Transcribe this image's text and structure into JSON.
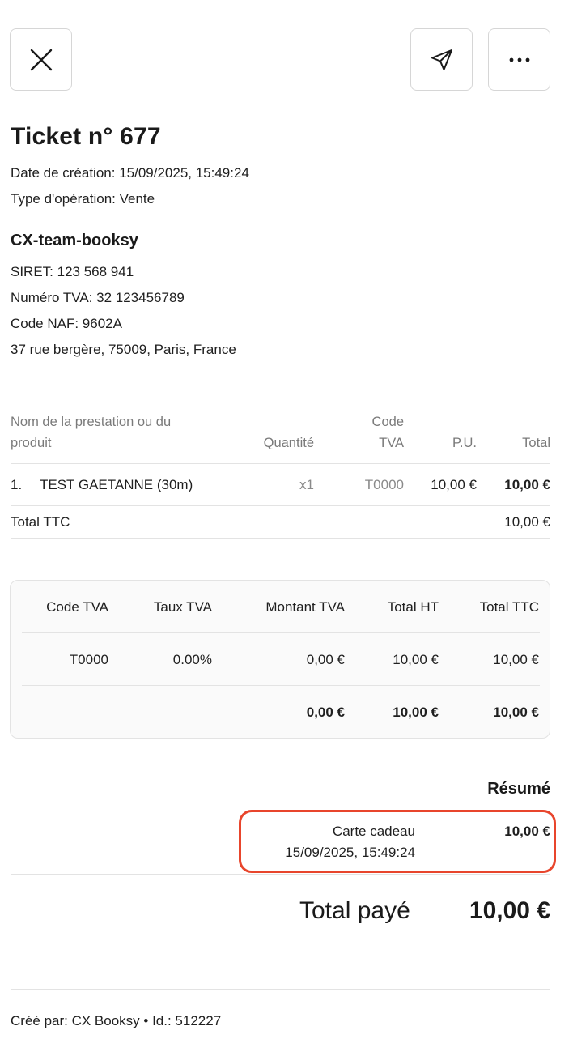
{
  "toolbar": {
    "close_icon": "close-icon",
    "send_icon": "send-icon",
    "more_icon": "more-icon"
  },
  "ticket": {
    "title": "Ticket n° 677",
    "created": "Date de création: 15/09/2025, 15:49:24",
    "operation": "Type d'opération: Vente"
  },
  "business": {
    "name": "CX-team-booksy",
    "siret": "SIRET: 123 568 941",
    "tva": "Numéro TVA: 32 123456789",
    "naf": "Code NAF: 9602A",
    "address": "37 rue bergère, 75009, Paris, France"
  },
  "items_table": {
    "headers": {
      "name_line1": "Nom de la prestation ou du",
      "name_line2": "produit",
      "quantity": "Quantité",
      "code_line1": "Code",
      "code_line2": "TVA",
      "unit_price": "P.U.",
      "total": "Total"
    },
    "rows": [
      {
        "index": "1.",
        "name": "TEST GAETANNE (30m)",
        "quantity": "x1",
        "code": "T0000",
        "unit_price": "10,00 €",
        "total": "10,00 €"
      }
    ],
    "total_ttc_label": "Total TTC",
    "total_ttc_value": "10,00 €"
  },
  "vat_table": {
    "headers": [
      "Code TVA",
      "Taux TVA",
      "Montant TVA",
      "Total HT",
      "Total TTC"
    ],
    "row": [
      "T0000",
      "0.00%",
      "0,00 €",
      "10,00 €",
      "10,00 €"
    ],
    "totals": [
      "0,00 €",
      "10,00 €",
      "10,00 €"
    ]
  },
  "summary": {
    "title": "Résumé",
    "payment_method": "Carte cadeau",
    "payment_date": "15/09/2025, 15:49:24",
    "payment_amount": "10,00 €",
    "total_label": "Total payé",
    "total_value": "10,00 €"
  },
  "footer": {
    "text": "Créé par: CX Booksy • Id.: 512227"
  },
  "colors": {
    "highlight": "#e8452c",
    "border": "#e3e3e3"
  }
}
